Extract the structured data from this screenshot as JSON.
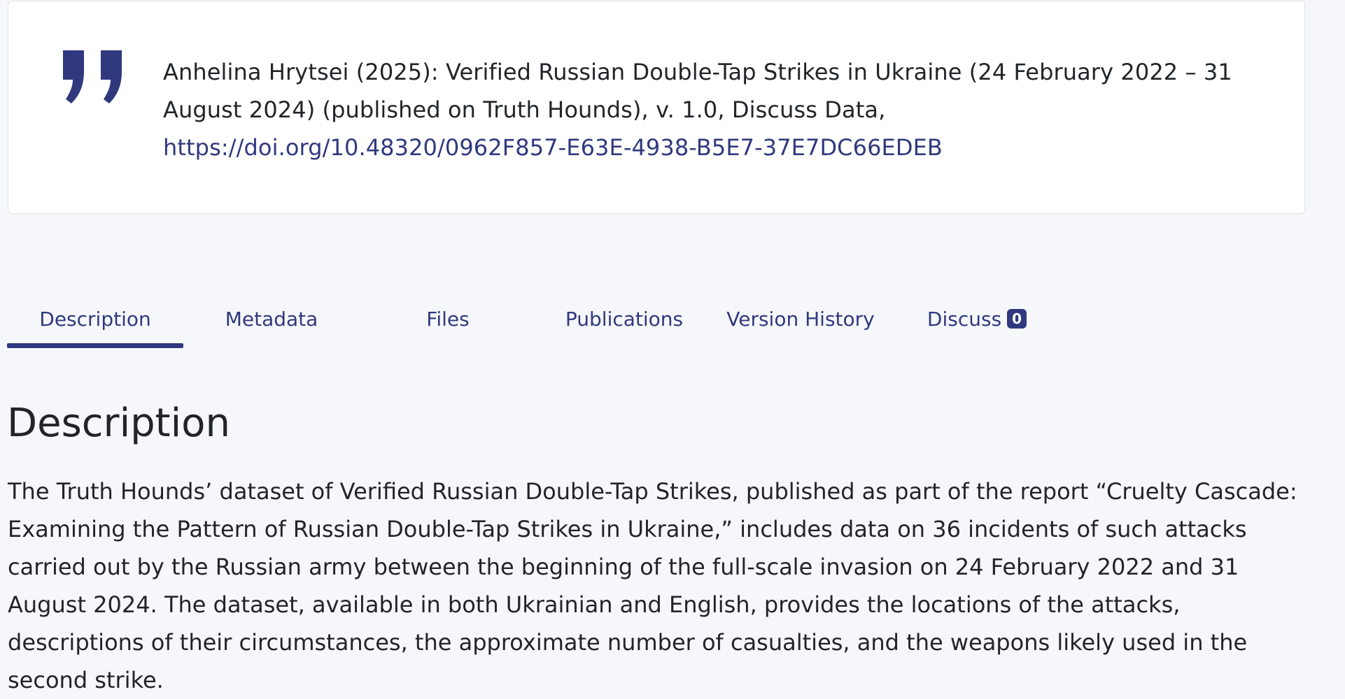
{
  "citation": {
    "text": "Anhelina Hrytsei (2025): Verified Russian Double-Tap Strikes in Ukraine (24 February 2022 – 31 August 2024) (published on Truth Hounds), v. 1.0, Discuss Data,",
    "doi_link": "https://doi.org/10.48320/0962F857-E63E-4938-B5E7-37E7DC66EDEB",
    "icon": "quote-icon"
  },
  "tabs": [
    {
      "label": "Description",
      "active": true
    },
    {
      "label": "Metadata",
      "active": false
    },
    {
      "label": "Files",
      "active": false
    },
    {
      "label": "Publications",
      "active": false
    },
    {
      "label": "Version History",
      "active": false
    },
    {
      "label": "Discuss",
      "active": false,
      "badge": "0"
    }
  ],
  "section": {
    "title": "Description",
    "body": "The Truth Hounds’ dataset of Verified Russian Double-Tap Strikes, published as part of the report “Cruelty Cascade: Examining the Pattern of Russian Double-Tap Strikes in Ukraine,” includes data on 36 incidents of such attacks carried out by the Russian army between the beginning of the full-scale invasion on 24 February 2022 and 31 August 2024. The dataset, available in both Ukrainian and English, provides the locations of the attacks, descriptions of their circumstances, the approximate number of casualties, and the weapons likely used in the second strike."
  },
  "colors": {
    "accent": "#30397e",
    "background": "#f6f7fa",
    "card": "#ffffff",
    "text": "#212529"
  }
}
